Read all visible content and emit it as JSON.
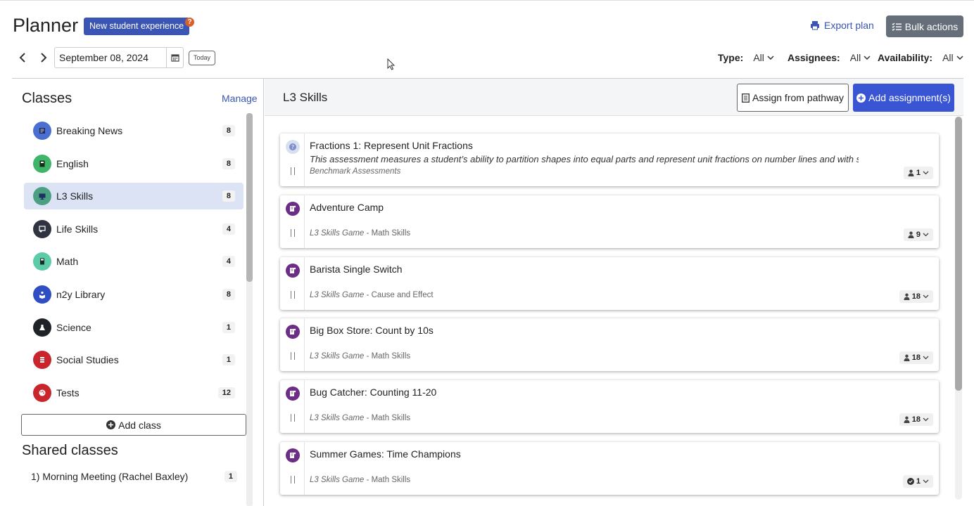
{
  "header": {
    "title": "Planner",
    "new_experience_label": "New student experience",
    "help_label": "?",
    "export_label": "Export plan",
    "bulk_label": "Bulk actions"
  },
  "datebar": {
    "date": "September 08, 2024",
    "today_label": "Today"
  },
  "filters": {
    "type_label": "Type:",
    "type_value": "All",
    "assignees_label": "Assignees:",
    "assignees_value": "All",
    "availability_label": "Availability:",
    "availability_value": "All"
  },
  "sidebar": {
    "heading": "Classes",
    "manage_label": "Manage",
    "classes": [
      {
        "name": "Breaking News",
        "count": "8",
        "color": "#4a6fd1",
        "icon": "newspaper-icon"
      },
      {
        "name": "English",
        "count": "8",
        "color": "#3fb56a",
        "icon": "book-icon"
      },
      {
        "name": "L3 Skills",
        "count": "8",
        "color": "#4aa080",
        "icon": "monitor-icon",
        "active": true
      },
      {
        "name": "Life Skills",
        "count": "4",
        "color": "#2f3440",
        "icon": "presentation-icon"
      },
      {
        "name": "Math",
        "count": "4",
        "color": "#5ccba8",
        "icon": "calculator-icon"
      },
      {
        "name": "n2y Library",
        "count": "8",
        "color": "#2f4ec4",
        "icon": "reader-icon"
      },
      {
        "name": "Science",
        "count": "1",
        "color": "#1f2226",
        "icon": "flask-icon"
      },
      {
        "name": "Social Studies",
        "count": "1",
        "color": "#c8262c",
        "icon": "flag-icon"
      },
      {
        "name": "Tests",
        "count": "12",
        "color": "#c8262c",
        "icon": "palette-icon"
      }
    ],
    "add_class_label": "Add class",
    "shared_heading": "Shared classes",
    "shared_items": [
      {
        "name": "1) Morning Meeting (Rachel Baxley)",
        "count": "1"
      }
    ]
  },
  "panel": {
    "title": "L3 Skills",
    "assign_pathway_label": "Assign from pathway",
    "add_assignment_label": "Add assignment(s)"
  },
  "assignments": [
    {
      "title": "Fractions 1: Represent Unit Fractions",
      "desc": "This assessment measures a student’s ability to partition shapes into equal parts and represent unit fractions on number lines and with shap…",
      "sub_italic": "Benchmark Assessments",
      "sub_rest": "",
      "badge": "1",
      "badge_icon": "person-icon",
      "icon": "benchmark-icon"
    },
    {
      "title": "Adventure Camp",
      "desc": "",
      "sub_italic": "L3 Skills Game",
      "sub_rest": " - Math Skills",
      "badge": "9",
      "badge_icon": "person-icon",
      "icon": "game-icon"
    },
    {
      "title": "Barista Single Switch",
      "desc": "",
      "sub_italic": "L3 Skills Game",
      "sub_rest": " - Cause and Effect",
      "badge": "18",
      "badge_icon": "person-icon",
      "icon": "game-icon"
    },
    {
      "title": "Big Box Store: Count by 10s",
      "desc": "",
      "sub_italic": "L3 Skills Game",
      "sub_rest": " - Math Skills",
      "badge": "18",
      "badge_icon": "person-icon",
      "icon": "game-icon"
    },
    {
      "title": "Bug Catcher: Counting 11-20",
      "desc": "",
      "sub_italic": "L3 Skills Game",
      "sub_rest": " - Math Skills",
      "badge": "18",
      "badge_icon": "person-icon",
      "icon": "game-icon"
    },
    {
      "title": "Summer Games: Time Champions",
      "desc": "",
      "sub_italic": "L3 Skills Game",
      "sub_rest": " - Math Skills",
      "badge": "1",
      "badge_icon": "check-circle-icon",
      "icon": "game-icon"
    }
  ]
}
